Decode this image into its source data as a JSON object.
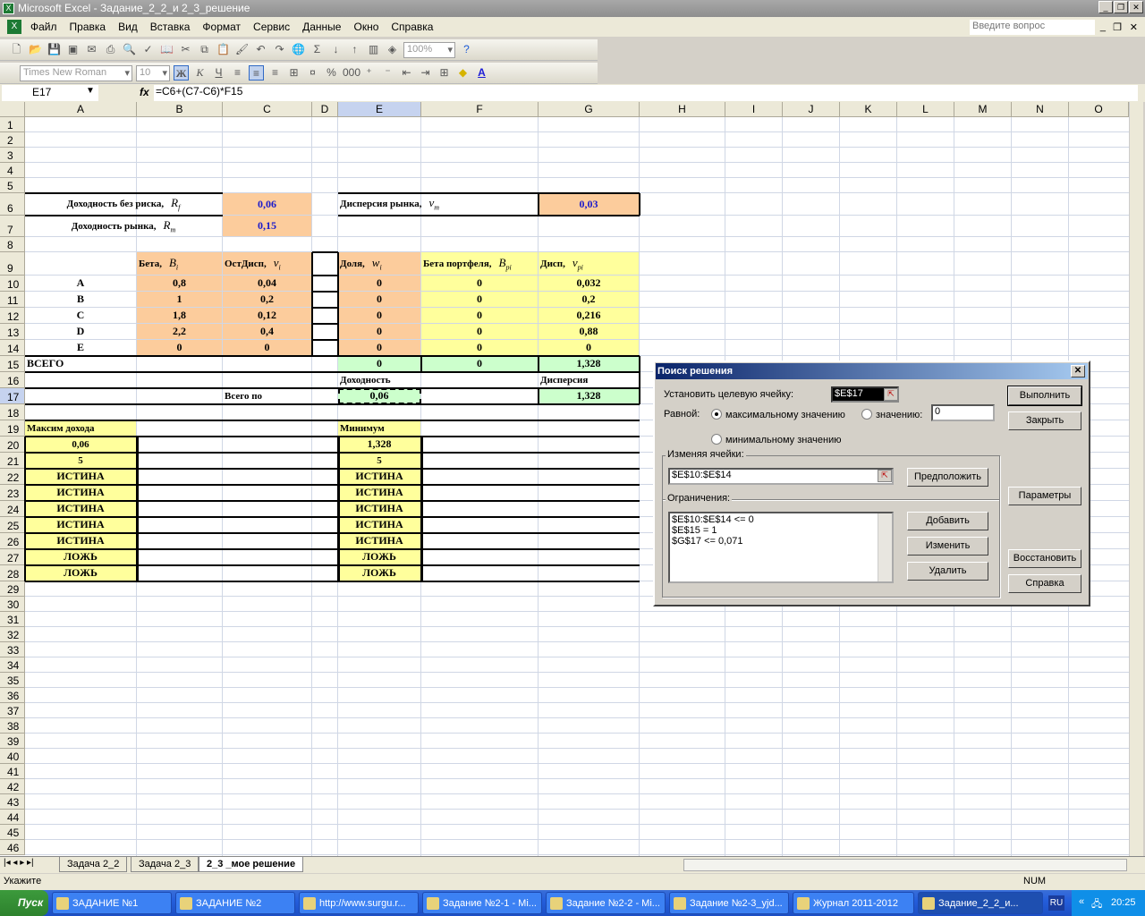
{
  "window": {
    "title": "Microsoft Excel - Задание_2_2_и 2_3_решение",
    "app_icon": "excel-icon"
  },
  "menu": [
    "Файл",
    "Правка",
    "Вид",
    "Вставка",
    "Формат",
    "Сервис",
    "Данные",
    "Окно",
    "Справка"
  ],
  "help_placeholder": "Введите вопрос",
  "toolbar": {
    "zoom": "100%",
    "font": "Times New Roman",
    "size": "10",
    "bold": "Ж",
    "italic": "К",
    "underline": "Ч"
  },
  "formula_bar": {
    "name_box": "E17",
    "fx": "fx",
    "formula": "=C6+(C7-C6)*F15"
  },
  "columns": [
    "A",
    "B",
    "C",
    "D",
    "E",
    "F",
    "G",
    "H",
    "I",
    "J",
    "K",
    "L",
    "M",
    "N",
    "O"
  ],
  "rows_visible": 46,
  "colors": {
    "input_fill": "#fccc9c",
    "calc_fill": "#ffff9c",
    "total_fill": "#ccffcc",
    "value_text": "#1a1acc"
  },
  "cells": [
    {
      "ref": "A6",
      "t": "Доходность без риска,",
      "sym": "R",
      "sub": "f"
    },
    {
      "ref": "C6",
      "t": "0,06"
    },
    {
      "ref": "E6",
      "t": "Дисперсия рынка,",
      "sym": "v",
      "sub": "m"
    },
    {
      "ref": "G6",
      "t": "0,03"
    },
    {
      "ref": "A7",
      "t": "Доходность рынка,",
      "sym": "R",
      "sub": "m"
    },
    {
      "ref": "C7",
      "t": "0,15"
    },
    {
      "ref": "B9",
      "t": "Бета,",
      "sym": "B",
      "sub": "i"
    },
    {
      "ref": "C9",
      "t": "ОстДисп,",
      "sym": "v",
      "sub": "i"
    },
    {
      "ref": "E9",
      "t": "Доля,",
      "sym": "w",
      "sub": "i"
    },
    {
      "ref": "F9",
      "t": "Бета портфеля,",
      "sym": "B",
      "sub": "pi"
    },
    {
      "ref": "G9",
      "t": "Дисп,",
      "sym": "v",
      "sub": "pi"
    },
    {
      "ref": "A10",
      "t": "A"
    },
    {
      "ref": "B10",
      "t": "0,8"
    },
    {
      "ref": "C10",
      "t": "0,04"
    },
    {
      "ref": "E10",
      "t": "0"
    },
    {
      "ref": "F10",
      "t": "0"
    },
    {
      "ref": "G10",
      "t": "0,032"
    },
    {
      "ref": "A11",
      "t": "B"
    },
    {
      "ref": "B11",
      "t": "1"
    },
    {
      "ref": "C11",
      "t": "0,2"
    },
    {
      "ref": "E11",
      "t": "0"
    },
    {
      "ref": "F11",
      "t": "0"
    },
    {
      "ref": "G11",
      "t": "0,2"
    },
    {
      "ref": "A12",
      "t": "C"
    },
    {
      "ref": "B12",
      "t": "1,8"
    },
    {
      "ref": "C12",
      "t": "0,12"
    },
    {
      "ref": "E12",
      "t": "0"
    },
    {
      "ref": "F12",
      "t": "0"
    },
    {
      "ref": "G12",
      "t": "0,216"
    },
    {
      "ref": "A13",
      "t": "D"
    },
    {
      "ref": "B13",
      "t": "2,2"
    },
    {
      "ref": "C13",
      "t": "0,4"
    },
    {
      "ref": "E13",
      "t": "0"
    },
    {
      "ref": "F13",
      "t": "0"
    },
    {
      "ref": "G13",
      "t": "0,88"
    },
    {
      "ref": "A14",
      "t": "E"
    },
    {
      "ref": "B14",
      "t": "0"
    },
    {
      "ref": "C14",
      "t": "0"
    },
    {
      "ref": "E14",
      "t": "0"
    },
    {
      "ref": "F14",
      "t": "0"
    },
    {
      "ref": "G14",
      "t": "0"
    },
    {
      "ref": "A15",
      "t": "ВСЕГО"
    },
    {
      "ref": "E15",
      "t": "0"
    },
    {
      "ref": "F15",
      "t": "0"
    },
    {
      "ref": "G15",
      "t": "1,328"
    },
    {
      "ref": "E16",
      "t": "Доходность"
    },
    {
      "ref": "G16",
      "t": "Дисперсия"
    },
    {
      "ref": "C17",
      "t": "Всего по"
    },
    {
      "ref": "E17",
      "t": "0,06"
    },
    {
      "ref": "G17",
      "t": "1,328"
    },
    {
      "ref": "A19",
      "t": "Максим дохода"
    },
    {
      "ref": "E19",
      "t": "Минимум"
    },
    {
      "ref": "A20",
      "t": "0,06"
    },
    {
      "ref": "E20",
      "t": "1,328"
    },
    {
      "ref": "A21",
      "t": "5"
    },
    {
      "ref": "E21",
      "t": "5"
    },
    {
      "ref": "A22",
      "t": "ИСТИНА"
    },
    {
      "ref": "E22",
      "t": "ИСТИНА"
    },
    {
      "ref": "A23",
      "t": "ИСТИНА"
    },
    {
      "ref": "E23",
      "t": "ИСТИНА"
    },
    {
      "ref": "A24",
      "t": "ИСТИНА"
    },
    {
      "ref": "E24",
      "t": "ИСТИНА"
    },
    {
      "ref": "A25",
      "t": "ИСТИНА"
    },
    {
      "ref": "E25",
      "t": "ИСТИНА"
    },
    {
      "ref": "A26",
      "t": "ИСТИНА"
    },
    {
      "ref": "E26",
      "t": "ИСТИНА"
    },
    {
      "ref": "A27",
      "t": "ЛОЖЬ"
    },
    {
      "ref": "E27",
      "t": "ЛОЖЬ"
    },
    {
      "ref": "A28",
      "t": "ЛОЖЬ"
    },
    {
      "ref": "E28",
      "t": "ЛОЖЬ"
    }
  ],
  "selected_cell": "E17",
  "sheet_tabs": [
    {
      "label": "Задача 2_2",
      "active": false
    },
    {
      "label": "Задача 2_3",
      "active": false
    },
    {
      "label": "2_3 _мое решение",
      "active": true
    }
  ],
  "status": {
    "text": "Укажите",
    "num": "NUM"
  },
  "solver": {
    "title": "Поиск решения",
    "target_label": "Установить целевую ячейку:",
    "target_value": "$E$17",
    "equal_label": "Равной:",
    "opt_max": "максимальному значению",
    "opt_value": "значению:",
    "opt_value_input": "0",
    "opt_min": "минимальному значению",
    "selected_option": "max",
    "changing_label": "Изменяя ячейки:",
    "changing_value": "$E$10:$E$14",
    "constraints_label": "Ограничения:",
    "constraints": [
      "$E$10:$E$14 <= 0",
      "$E$15 = 1",
      "$G$17 <= 0,071"
    ],
    "buttons": {
      "run": "Выполнить",
      "close": "Закрыть",
      "guess": "Предположить",
      "params": "Параметры",
      "add": "Добавить",
      "change": "Изменить",
      "delete": "Удалить",
      "reset": "Восстановить",
      "help": "Справка"
    }
  },
  "taskbar": {
    "start": "Пуск",
    "items": [
      {
        "label": "ЗАДАНИЕ №1",
        "active": false
      },
      {
        "label": "ЗАДАНИЕ №2",
        "active": false
      },
      {
        "label": "http://www.surgu.r...",
        "active": false
      },
      {
        "label": "Задание №2-1 - Mi...",
        "active": false
      },
      {
        "label": "Задание №2-2 - Mi...",
        "active": false
      },
      {
        "label": "Задание №2-3_yjd...",
        "active": false
      },
      {
        "label": "Журнал 2011-2012",
        "active": false
      },
      {
        "label": "Задание_2_2_и...",
        "active": true
      }
    ],
    "lang": "RU",
    "clock": "20:25"
  }
}
